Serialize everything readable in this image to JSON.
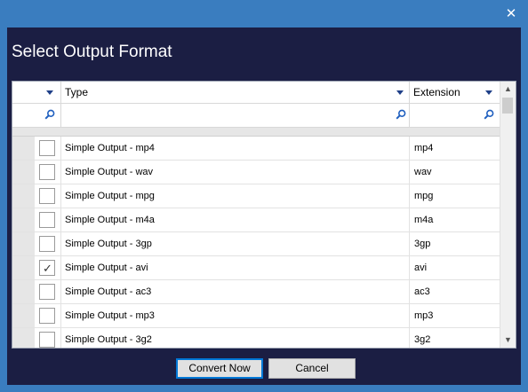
{
  "window": {
    "close_glyph": "✕"
  },
  "dialog": {
    "title": "Select Output Format"
  },
  "grid": {
    "columns": {
      "type_header": "Type",
      "extension_header": "Extension"
    },
    "rows": [
      {
        "type": "Simple Output - mp4",
        "ext": "mp4",
        "checked": false
      },
      {
        "type": "Simple Output - wav",
        "ext": "wav",
        "checked": false
      },
      {
        "type": "Simple Output - mpg",
        "ext": "mpg",
        "checked": false
      },
      {
        "type": "Simple Output - m4a",
        "ext": "m4a",
        "checked": false
      },
      {
        "type": "Simple Output - 3gp",
        "ext": "3gp",
        "checked": false
      },
      {
        "type": "Simple Output - avi",
        "ext": "avi",
        "checked": true
      },
      {
        "type": "Simple Output - ac3",
        "ext": "ac3",
        "checked": false
      },
      {
        "type": "Simple Output - mp3",
        "ext": "mp3",
        "checked": false
      },
      {
        "type": "Simple Output - 3g2",
        "ext": "3g2",
        "checked": false
      }
    ]
  },
  "buttons": {
    "convert_label": "Convert Now",
    "cancel_label": "Cancel"
  },
  "icons": {
    "filter_search": "search-icon",
    "column_dropdown": "chevron-down-icon"
  },
  "colors": {
    "window_frame": "#3a7dbf",
    "dialog_background": "#1b1e43",
    "grid_background": "#ffffff",
    "accent_border": "#0078d7"
  }
}
